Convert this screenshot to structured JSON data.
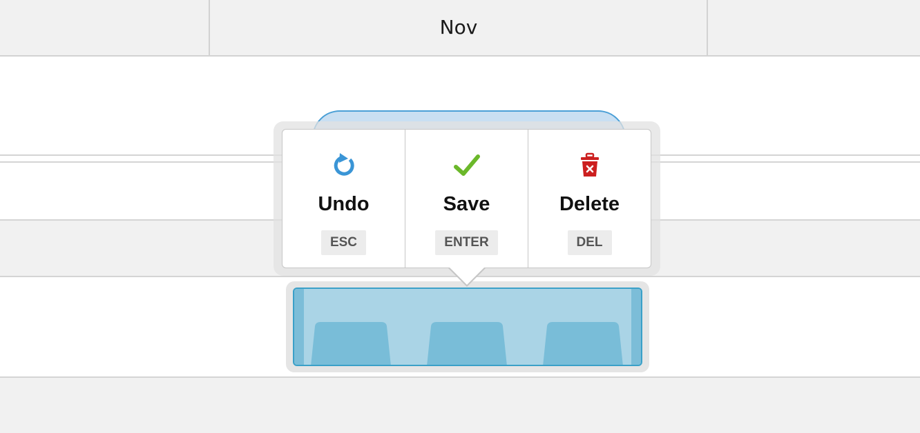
{
  "timeline": {
    "month": "Nov"
  },
  "popup": {
    "actions": [
      {
        "label": "Undo",
        "shortcut": "ESC",
        "icon": "undo-icon"
      },
      {
        "label": "Save",
        "shortcut": "ENTER",
        "icon": "check-icon"
      },
      {
        "label": "Delete",
        "shortcut": "DEL",
        "icon": "trash-icon"
      }
    ]
  },
  "colors": {
    "undo": "#3a95d6",
    "save": "#6bb82a",
    "delete": "#cc1f1f",
    "selection_fill": "#aad4e6",
    "selection_border": "#3aa0c8"
  }
}
